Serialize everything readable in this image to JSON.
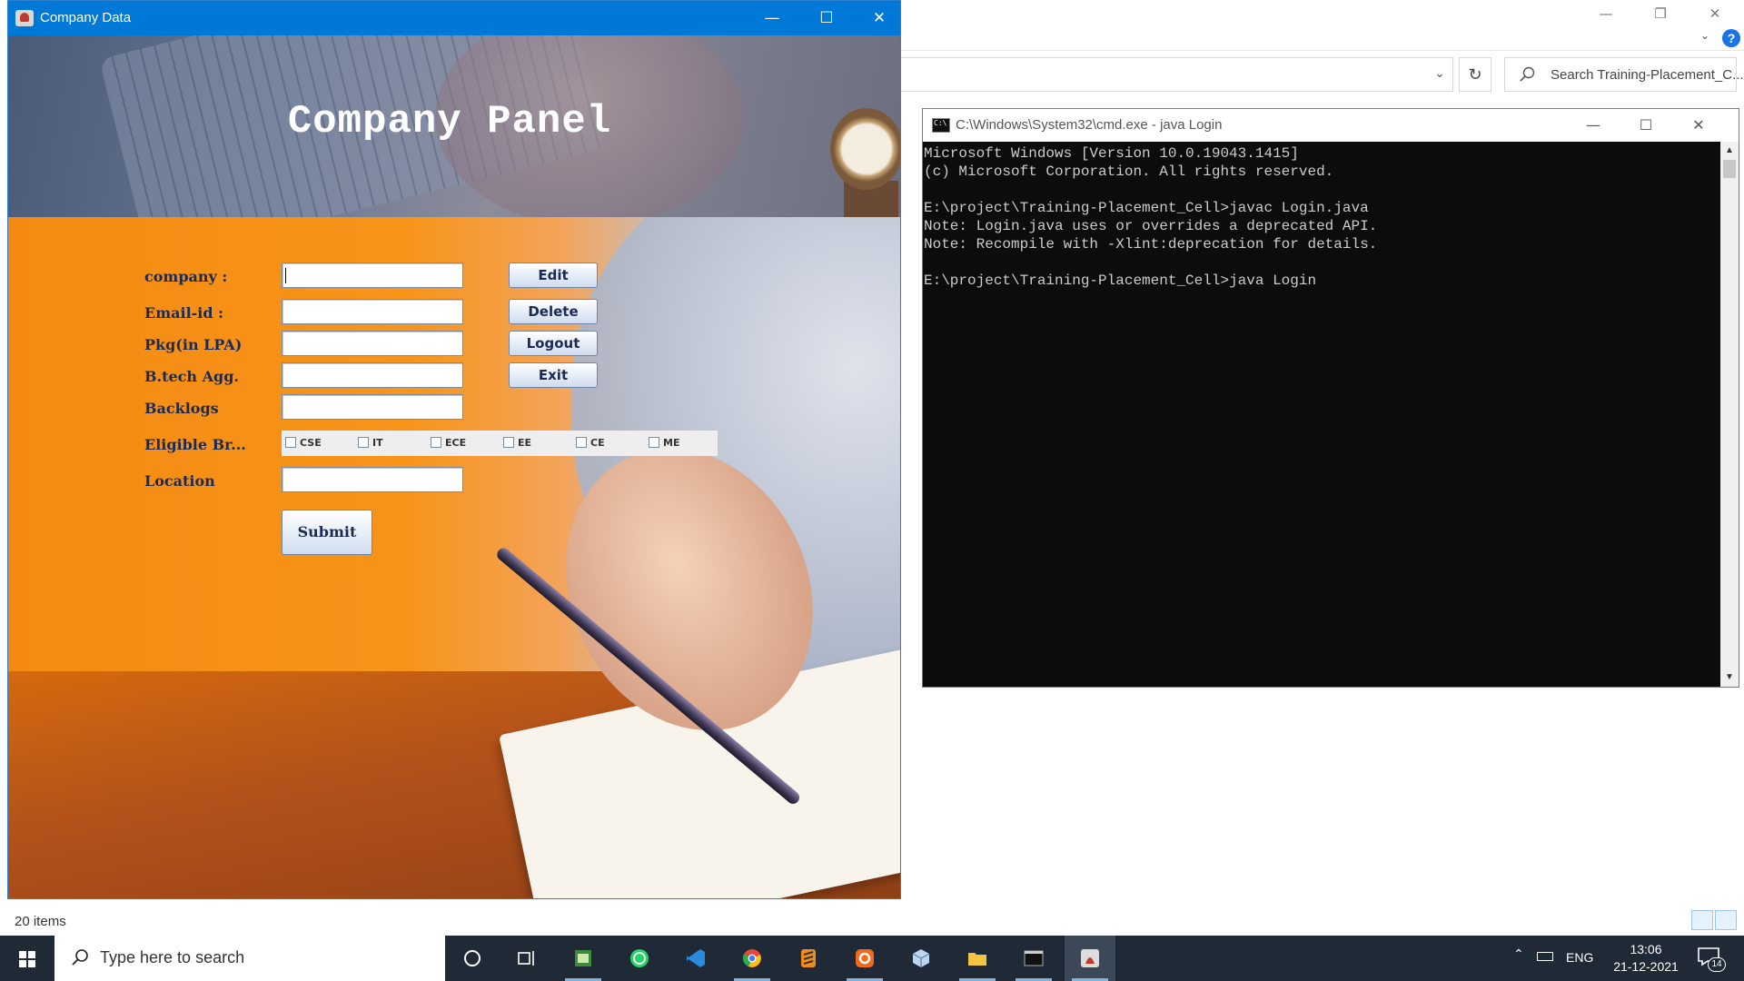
{
  "explorer": {
    "search_placeholder": "Search Training-Placement_C...",
    "status": "20 items",
    "help": "?"
  },
  "cmd": {
    "title": "C:\\Windows\\System32\\cmd.exe - java  Login",
    "lines": [
      "Microsoft Windows [Version 10.0.19043.1415]",
      "(c) Microsoft Corporation. All rights reserved.",
      "",
      "E:\\project\\Training-Placement_Cell>javac Login.java",
      "Note: Login.java uses or overrides a deprecated API.",
      "Note: Recompile with -Xlint:deprecation for details.",
      "",
      "E:\\project\\Training-Placement_Cell>java Login"
    ]
  },
  "app": {
    "title": "Company Data",
    "heading": "Company Panel",
    "labels": {
      "company": "company :",
      "email": "Email-id :",
      "pkg": "Pkg(in LPA)",
      "btech": "B.tech Agg.",
      "backlogs": "Backlogs",
      "branches": "Eligible Br...",
      "location": "Location"
    },
    "fields": {
      "company": "",
      "email": "",
      "pkg": "",
      "btech": "",
      "backlogs": "",
      "location": ""
    },
    "buttons": {
      "edit": "Edit",
      "delete": "Delete",
      "logout": "Logout",
      "exit": "Exit",
      "submit": "Submit"
    },
    "branches": [
      {
        "label": "CSE",
        "checked": false
      },
      {
        "label": "IT",
        "checked": false
      },
      {
        "label": "ECE",
        "checked": false
      },
      {
        "label": "EE",
        "checked": false
      },
      {
        "label": "CE",
        "checked": false
      },
      {
        "label": "ME",
        "checked": false
      }
    ]
  },
  "taskbar": {
    "search_placeholder": "Type here to search",
    "language": "ENG",
    "time": "13:06",
    "date": "21-12-2021",
    "notification_count": "14",
    "icons": [
      "cortana-icon",
      "task-view-icon",
      "notepad-icon",
      "whatsapp-icon",
      "vscode-icon",
      "chrome-icon",
      "sublime-icon",
      "xampp-icon",
      "box-icon",
      "file-explorer-icon",
      "terminal-icon",
      "java-app-icon"
    ]
  },
  "colors": {
    "titlebar_active": "#0078d7",
    "taskbar": "#1f2a36",
    "form_label": "#1a2a55"
  }
}
